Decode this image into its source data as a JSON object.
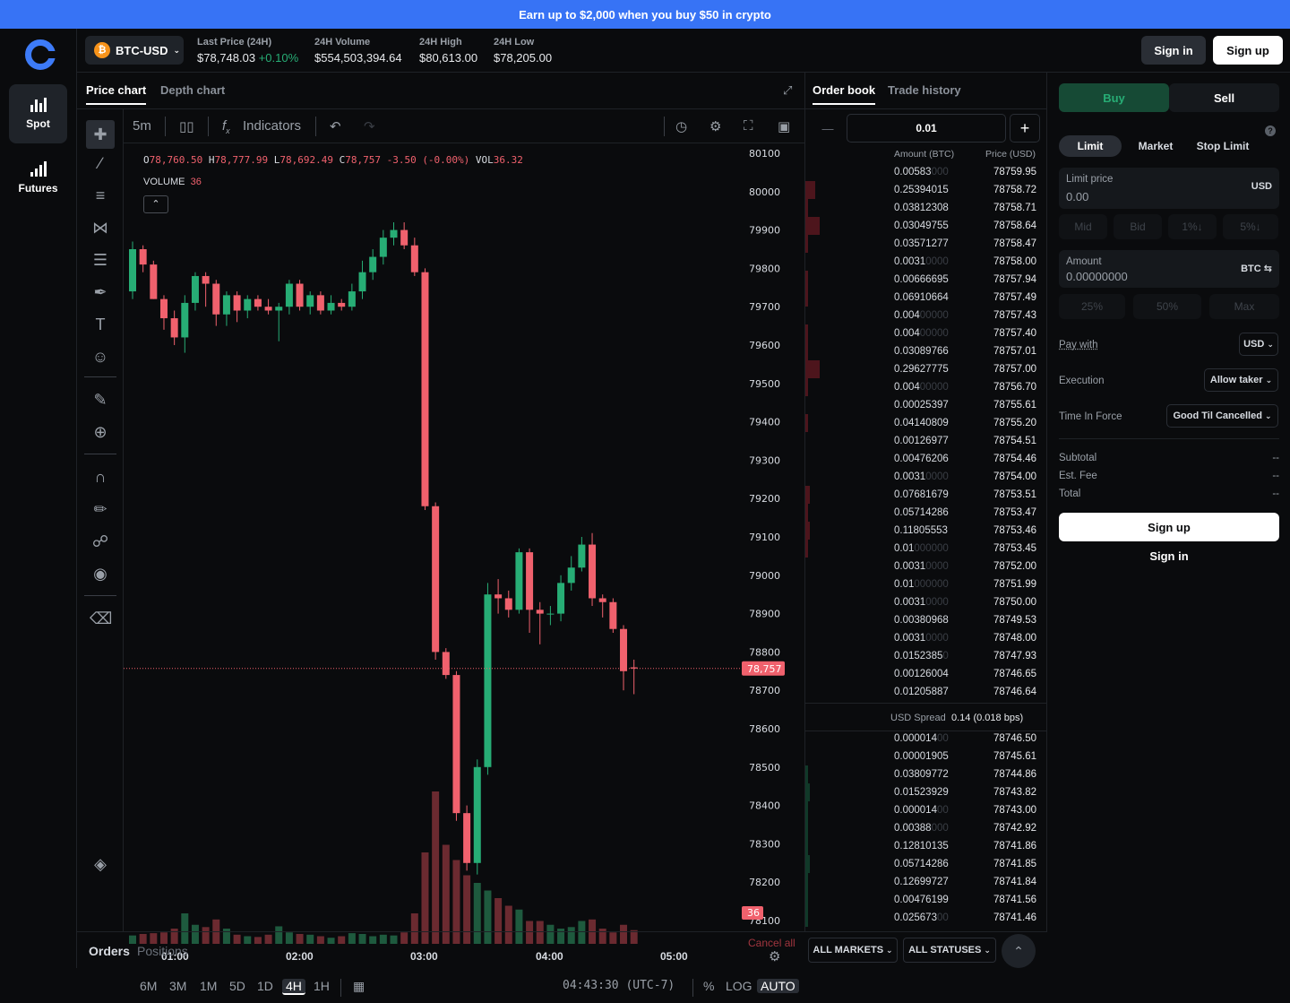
{
  "banner": {
    "text": "Earn up to $2,000 when you buy $50 in crypto"
  },
  "nav": {
    "spot": "Spot",
    "futures": "Futures"
  },
  "header": {
    "pair": "BTC-USD",
    "pair_icon": "₿",
    "stats": [
      {
        "label": "Last Price (24H)",
        "value": "$78,748.03",
        "change": "+0.10%"
      },
      {
        "label": "24H Volume",
        "value": "$554,503,394.64"
      },
      {
        "label": "24H High",
        "value": "$80,613.00"
      },
      {
        "label": "24H Low",
        "value": "$78,205.00"
      }
    ],
    "sign_in": "Sign in",
    "sign_up": "Sign up"
  },
  "chart": {
    "tabs": [
      "Price chart",
      "Depth chart"
    ],
    "interval": "5m",
    "indicators": "Indicators",
    "ohlc": {
      "o": "78,760.50",
      "h": "78,777.99",
      "l": "78,692.49",
      "c": "78,757",
      "chg": "-3.50 (-0.00%)",
      "vol": "36.32"
    },
    "ohlc_labels": {
      "o": "O",
      "h": "H",
      "l": "L",
      "c": "C",
      "vol": "VOL"
    },
    "volume_label": "VOLUME",
    "volume_value": "36",
    "last_price_tag": "78,757",
    "volume_tag": "36",
    "ranges": [
      "6M",
      "3M",
      "1M",
      "5D",
      "1D",
      "4H",
      "1H"
    ],
    "active_range": "4H",
    "clock": "04:43:30 (UTC-7)",
    "scale_buttons": [
      "%",
      "LOG",
      "AUTO"
    ],
    "colors": {
      "up": "#27ad75",
      "down": "#f0616d",
      "up_vol": "#1e5a3e",
      "down_vol": "#6b2a30"
    }
  },
  "chart_data": {
    "type": "candlestick",
    "x_ticks": [
      "01:00",
      "02:00",
      "03:00",
      "04:00",
      "05:00"
    ],
    "y_ticks": [
      80100,
      80000,
      79900,
      79800,
      79700,
      79600,
      79500,
      79400,
      79300,
      79200,
      79100,
      79000,
      78900,
      78800,
      78700,
      78600,
      78500,
      78400,
      78300,
      78200,
      78100
    ],
    "ylim": [
      78100,
      80100
    ],
    "candles": [
      [
        79740,
        79850,
        79740,
        79720,
        79870,
        1.1
      ],
      [
        79850,
        79810,
        79760,
        79790,
        79860,
        1.3
      ],
      [
        79810,
        79720,
        79700,
        79720,
        79820,
        1.4
      ],
      [
        79720,
        79670,
        79650,
        79640,
        79730,
        1.5
      ],
      [
        79670,
        79620,
        79600,
        79600,
        79690,
        2.0
      ],
      [
        79620,
        79710,
        79600,
        79580,
        79730,
        4.0
      ],
      [
        79710,
        79780,
        79700,
        79690,
        79790,
        2.5
      ],
      [
        79780,
        79760,
        79720,
        79700,
        79790,
        2.2
      ],
      [
        79760,
        79680,
        79660,
        79650,
        79770,
        3.2
      ],
      [
        79680,
        79730,
        79670,
        79650,
        79740,
        2.0
      ],
      [
        79730,
        79690,
        79680,
        79660,
        79740,
        1.2
      ],
      [
        79690,
        79720,
        79680,
        79670,
        79730,
        1.0
      ],
      [
        79720,
        79700,
        79700,
        79690,
        79730,
        0.9
      ],
      [
        79700,
        79690,
        79680,
        79680,
        79720,
        1.2
      ],
      [
        79690,
        79700,
        79680,
        79610,
        79710,
        2.3
      ],
      [
        79700,
        79760,
        79690,
        79680,
        79770,
        1.5
      ],
      [
        79760,
        79700,
        79690,
        79690,
        79770,
        1.3
      ],
      [
        79700,
        79730,
        79690,
        79680,
        79740,
        1.2
      ],
      [
        79730,
        79690,
        79690,
        79680,
        79740,
        1.0
      ],
      [
        79690,
        79710,
        79690,
        79680,
        79730,
        0.8
      ],
      [
        79710,
        79700,
        79700,
        79690,
        79720,
        1.0
      ],
      [
        79700,
        79740,
        79690,
        79690,
        79760,
        1.4
      ],
      [
        79740,
        79790,
        79730,
        79720,
        79820,
        1.3
      ],
      [
        79790,
        79830,
        79780,
        79770,
        79850,
        1.0
      ],
      [
        79830,
        79880,
        79820,
        79810,
        79900,
        1.2
      ],
      [
        79880,
        79900,
        79870,
        79860,
        79920,
        1.1
      ],
      [
        79900,
        79860,
        79860,
        79850,
        79920,
        1.5
      ],
      [
        79860,
        79790,
        79790,
        79780,
        79880,
        4.0
      ],
      [
        79790,
        79180,
        79180,
        79170,
        79800,
        12.0
      ],
      [
        79180,
        78800,
        78800,
        78780,
        79190,
        20.0
      ],
      [
        78800,
        78740,
        78740,
        78730,
        78810,
        13.0
      ],
      [
        78740,
        78380,
        78380,
        78360,
        78750,
        11.0
      ],
      [
        78380,
        78250,
        78250,
        78230,
        78400,
        9.0
      ],
      [
        78250,
        78500,
        78230,
        78220,
        78520,
        8.0
      ],
      [
        78500,
        78950,
        78490,
        78480,
        78980,
        7.0
      ],
      [
        78950,
        78940,
        78920,
        78900,
        78990,
        6.0
      ],
      [
        78940,
        78910,
        78900,
        78890,
        78960,
        5.0
      ],
      [
        78910,
        79060,
        78900,
        78900,
        79070,
        4.5
      ],
      [
        79060,
        78910,
        78900,
        78850,
        79070,
        3.0
      ],
      [
        78910,
        78900,
        78890,
        78820,
        78930,
        3.0
      ],
      [
        78900,
        78900,
        78890,
        78870,
        78920,
        2.5
      ],
      [
        78900,
        78980,
        78890,
        78880,
        79000,
        2.0
      ],
      [
        78980,
        79020,
        78960,
        78960,
        79050,
        2.2
      ],
      [
        79020,
        79080,
        79010,
        79010,
        79100,
        3.0
      ],
      [
        79080,
        78940,
        78930,
        78920,
        79110,
        3.2
      ],
      [
        78940,
        78930,
        78920,
        78890,
        78950,
        2.0
      ],
      [
        78930,
        78860,
        78860,
        78850,
        78940,
        1.5
      ],
      [
        78860,
        78750,
        78740,
        78700,
        78870,
        2.5
      ],
      [
        78760,
        78757,
        78750,
        78690,
        78780,
        1.8
      ]
    ],
    "candle_fields": [
      "open",
      "close",
      "_",
      "low",
      "high",
      "volume"
    ]
  },
  "orderbook": {
    "tabs": [
      "Order book",
      "Trade history"
    ],
    "step": "0.01",
    "minus": "—",
    "plus": "+",
    "col_amount": "Amount (BTC)",
    "col_price": "Price (USD)",
    "asks": [
      {
        "a": "0.00583",
        "z": "000",
        "p": "78759.95",
        "d": 0
      },
      {
        "a": "0.25394015",
        "z": "",
        "p": "78758.72",
        "d": 0.04
      },
      {
        "a": "0.03812308",
        "z": "",
        "p": "78758.71",
        "d": 0.01
      },
      {
        "a": "0.03049755",
        "z": "",
        "p": "78758.64",
        "d": 0.06
      },
      {
        "a": "0.03571277",
        "z": "",
        "p": "78758.47",
        "d": 0.01
      },
      {
        "a": "0.0031",
        "z": "0000",
        "p": "78758.00",
        "d": 0
      },
      {
        "a": "0.00666695",
        "z": "",
        "p": "78757.94",
        "d": 0.01
      },
      {
        "a": "0.06910664",
        "z": "",
        "p": "78757.49",
        "d": 0.01
      },
      {
        "a": "0.004",
        "z": "00000",
        "p": "78757.43",
        "d": 0
      },
      {
        "a": "0.004",
        "z": "00000",
        "p": "78757.40",
        "d": 0.01
      },
      {
        "a": "0.03089766",
        "z": "",
        "p": "78757.01",
        "d": 0.01
      },
      {
        "a": "0.29627775",
        "z": "",
        "p": "78757.00",
        "d": 0.06
      },
      {
        "a": "0.004",
        "z": "00000",
        "p": "78756.70",
        "d": 0.01
      },
      {
        "a": "0.00025397",
        "z": "",
        "p": "78755.61",
        "d": 0
      },
      {
        "a": "0.04140809",
        "z": "",
        "p": "78755.20",
        "d": 0.01
      },
      {
        "a": "0.00126977",
        "z": "",
        "p": "78754.51",
        "d": 0
      },
      {
        "a": "0.00476206",
        "z": "",
        "p": "78754.46",
        "d": 0
      },
      {
        "a": "0.0031",
        "z": "0000",
        "p": "78754.00",
        "d": 0
      },
      {
        "a": "0.07681679",
        "z": "",
        "p": "78753.51",
        "d": 0.02
      },
      {
        "a": "0.05714286",
        "z": "",
        "p": "78753.47",
        "d": 0.01
      },
      {
        "a": "0.11805553",
        "z": "",
        "p": "78753.46",
        "d": 0.02
      },
      {
        "a": "0.01",
        "z": "000000",
        "p": "78753.45",
        "d": 0.01
      },
      {
        "a": "0.0031",
        "z": "0000",
        "p": "78752.00",
        "d": 0
      },
      {
        "a": "0.01",
        "z": "000000",
        "p": "78751.99",
        "d": 0
      },
      {
        "a": "0.0031",
        "z": "0000",
        "p": "78750.00",
        "d": 0
      },
      {
        "a": "0.00380968",
        "z": "",
        "p": "78749.53",
        "d": 0
      },
      {
        "a": "0.0031",
        "z": "0000",
        "p": "78748.00",
        "d": 0
      },
      {
        "a": "0.0152385",
        "z": "0",
        "p": "78747.93",
        "d": 0
      },
      {
        "a": "0.00126004",
        "z": "",
        "p": "78746.65",
        "d": 0
      },
      {
        "a": "0.01205887",
        "z": "",
        "p": "78746.64",
        "d": 0
      }
    ],
    "spread_label": "USD Spread",
    "spread_value": "0.14 (0.018 bps)",
    "bids": [
      {
        "a": "0.000014",
        "z": "00",
        "p": "78746.50",
        "d": 0
      },
      {
        "a": "0.00001905",
        "z": "",
        "p": "78745.61",
        "d": 0
      },
      {
        "a": "0.03809772",
        "z": "",
        "p": "78744.86",
        "d": 0.01
      },
      {
        "a": "0.01523929",
        "z": "",
        "p": "78743.82",
        "d": 0.02
      },
      {
        "a": "0.000014",
        "z": "00",
        "p": "78743.00",
        "d": 0.01
      },
      {
        "a": "0.00388",
        "z": "000",
        "p": "78742.92",
        "d": 0.01
      },
      {
        "a": "0.12810135",
        "z": "",
        "p": "78741.86",
        "d": 0.01
      },
      {
        "a": "0.05714286",
        "z": "",
        "p": "78741.85",
        "d": 0.02
      },
      {
        "a": "0.12699727",
        "z": "",
        "p": "78741.84",
        "d": 0.01
      },
      {
        "a": "0.00476199",
        "z": "",
        "p": "78741.56",
        "d": 0.01
      },
      {
        "a": "0.025673",
        "z": "00",
        "p": "78741.46",
        "d": 0.01
      }
    ]
  },
  "trade": {
    "buy": "Buy",
    "sell": "Sell",
    "order_types": [
      "Limit",
      "Market",
      "Stop Limit"
    ],
    "info_icon": "?",
    "limit_label": "Limit price",
    "limit_value": "0.00",
    "limit_unit": "USD",
    "price_chips": [
      "Mid",
      "Bid",
      "1%↓",
      "5%↓"
    ],
    "amount_label": "Amount",
    "amount_value": "0.00000000",
    "amount_unit": "BTC ⇆",
    "amount_chips": [
      "25%",
      "50%",
      "Max"
    ],
    "pay_with_label": "Pay with",
    "pay_with_value": "USD",
    "execution_label": "Execution",
    "execution_value": "Allow taker",
    "tif_label": "Time In Force",
    "tif_value": "Good Til Cancelled",
    "subtotal_label": "Subtotal",
    "fee_label": "Est. Fee",
    "total_label": "Total",
    "dash": "--",
    "sign_up": "Sign up",
    "sign_in": "Sign in"
  },
  "bottom": {
    "orders": "Orders",
    "positions": "Positions",
    "cancel_all": "Cancel all",
    "markets": "ALL MARKETS",
    "statuses": "ALL STATUSES"
  }
}
